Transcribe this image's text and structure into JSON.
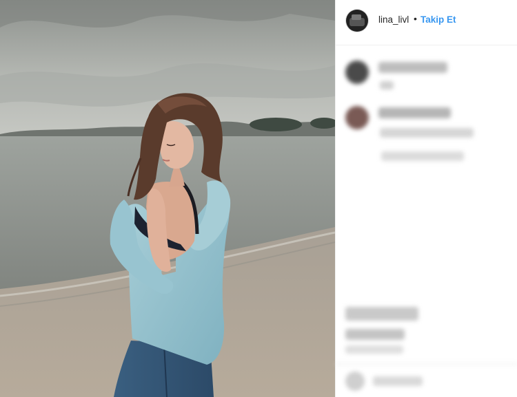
{
  "post": {
    "username": "lina_livl",
    "separator": "•",
    "follow_label": "Takip Et"
  },
  "icons": {
    "avatar": "profile-avatar-icon"
  },
  "colors": {
    "follow_link": "#3897f0",
    "username_text": "#262626"
  }
}
